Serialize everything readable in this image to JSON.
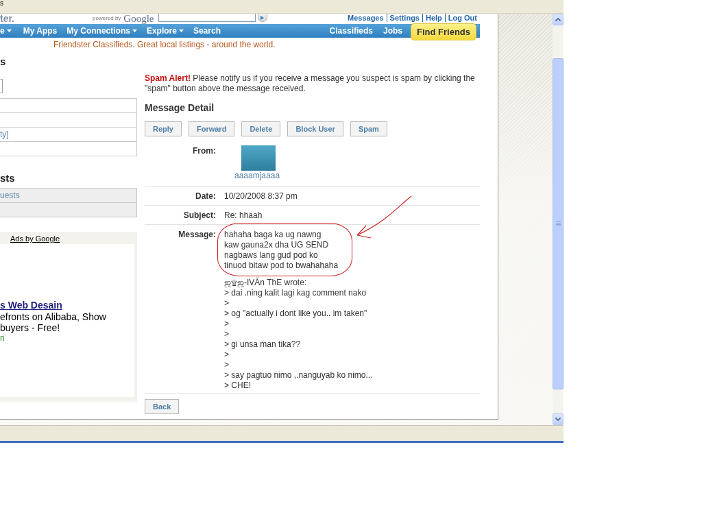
{
  "top_strip": {
    "text": "s"
  },
  "header": {
    "logo": "ter.",
    "powered_by": "powered by",
    "google": "Google",
    "links": [
      "Messages",
      "Settings",
      "Help",
      "Log Out"
    ]
  },
  "nav": {
    "items": [
      {
        "label": "e",
        "dropdown": true
      },
      {
        "label": "My Apps",
        "dropdown": false
      },
      {
        "label": "My Connections",
        "dropdown": true
      },
      {
        "label": "Explore",
        "dropdown": true
      },
      {
        "label": "Search",
        "dropdown": false
      }
    ],
    "right_items": [
      "Classifieds",
      "Jobs"
    ],
    "highlight": "Find Friends"
  },
  "tagline": "Friendster Classifieds. Great local listings - around the world.",
  "sidebar": {
    "heading_1": "s",
    "link_1": "ty]",
    "heading_2": "sts",
    "link_2": "uests",
    "ads": {
      "label": "Ads by Google",
      "title": "s Web Desain",
      "text": "efronts on Alibaba, Show buyers - Free!",
      "url": "n"
    }
  },
  "message": {
    "spam_alert": "**Spam Alert!** Please notify us if you receive a message you suspect is spam by clicking the \"spam\" button above the message received.",
    "title": "Message Detail",
    "actions": [
      "Reply",
      "Forward",
      "Delete",
      "Block User",
      "Spam"
    ],
    "fields": [
      {
        "kind": "sender",
        "label": "From:",
        "value": "aaaamjaaaa"
      },
      {
        "kind": "text",
        "label": "Date:",
        "value": "10/20/2008 8:37 pm"
      },
      {
        "kind": "text",
        "label": "Subject:",
        "value": "Re: hhaah"
      },
      {
        "kind": "body",
        "label": "Message:",
        "reply": [
          "hahaha baga ka ug nawng",
          "kaw gauna2x dha UG SEND",
          "nagbaws lang gud pod ko",
          "tinuod bitaw pod to bwahahaha"
        ],
        "quote": [
          "ஜ۩ஜ-IVÃn ThE wrote:",
          "> dai .ning kalit lagi kag comment nako",
          ">",
          "> og \"actually i dont like you.. im taken\"",
          ">",
          ">",
          "> gi unsa man tika??",
          ">",
          ">",
          "> say pagtuo nimo ,.nanguyab ko nimo...",
          "> CHE!"
        ]
      }
    ],
    "back": "Back"
  }
}
